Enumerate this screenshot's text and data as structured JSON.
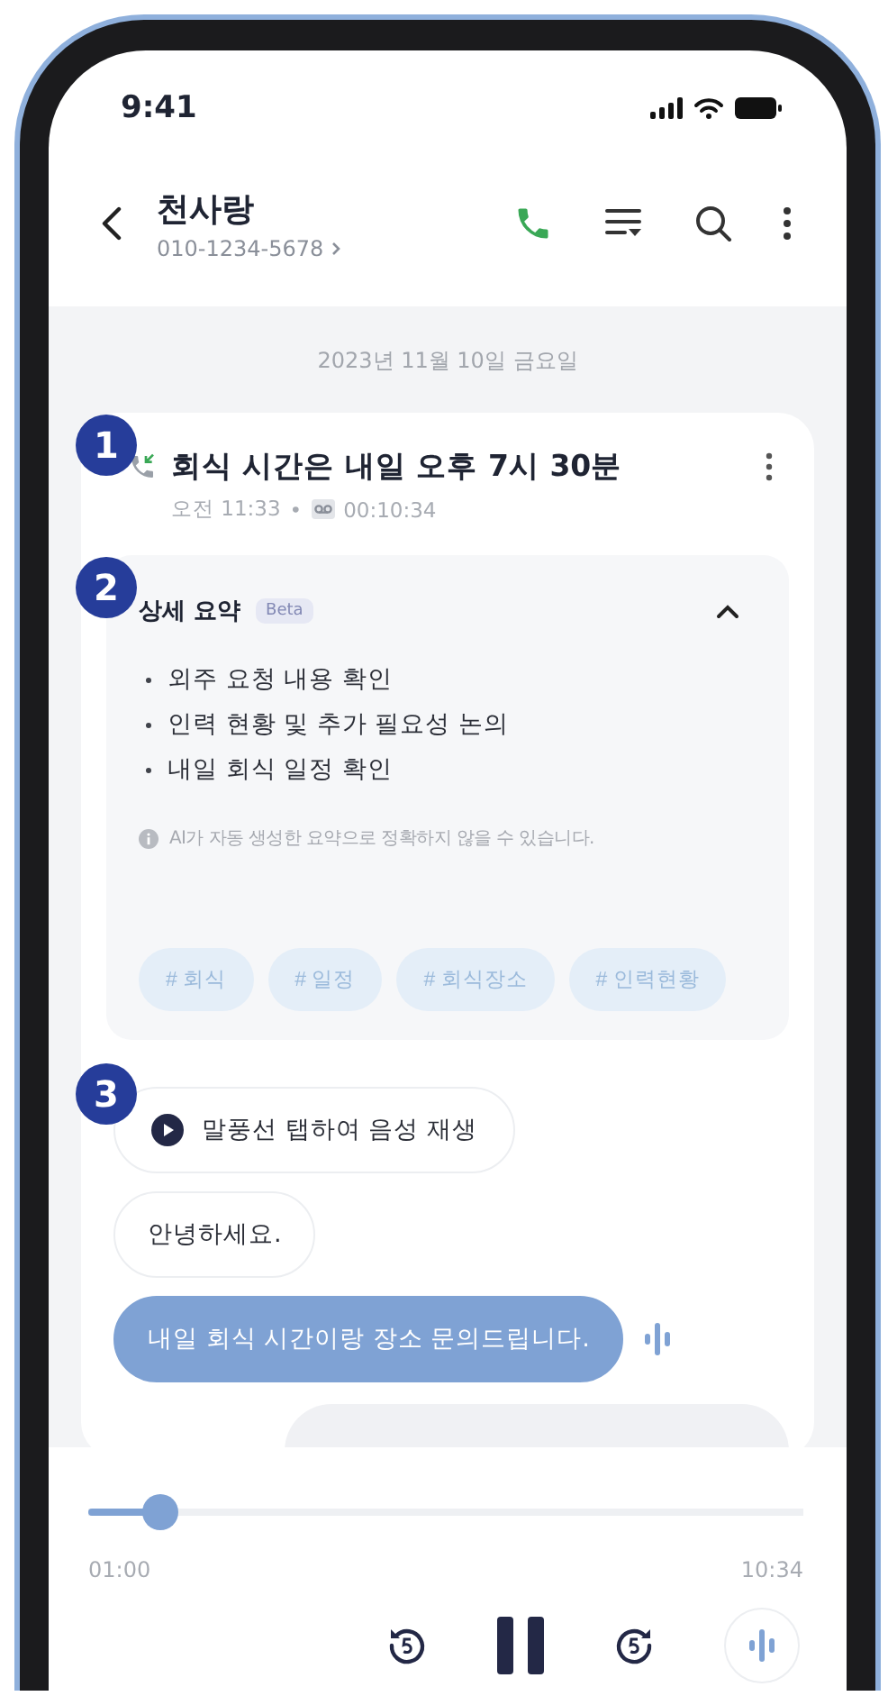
{
  "status_bar": {
    "time": "9:41"
  },
  "header": {
    "contact_name": "천사랑",
    "phone_number": "010-1234-5678"
  },
  "date_divider": "2023년 11월 10일 금요일",
  "call_card": {
    "title": "회식 시간은 내일 오후 7시 30분",
    "time": "오전 11:33",
    "separator": "•",
    "duration": "00:10:34"
  },
  "summary": {
    "title": "상세 요약",
    "badge": "Beta",
    "expanded": true,
    "points": [
      "외주 요청 내용 확인",
      "인력 현황 및 추가 필요성 논의",
      "내일 회식 일정 확인"
    ],
    "notice": "AI가 자동 생성한 요약으로 정확하지 않을 수 있습니다.",
    "tags": [
      "# 회식",
      "# 일정",
      "# 회식장소",
      "# 인력현황"
    ]
  },
  "messages": [
    {
      "kind": "hint",
      "text": "말풍선 탭하여 음성 재생"
    },
    {
      "kind": "bubble",
      "text": "안녕하세요.",
      "selected": false
    },
    {
      "kind": "bubble",
      "text": "내일 회식 시간이랑 장소 문의드립니다.",
      "selected": true
    }
  ],
  "player": {
    "level": 0.1,
    "elapsed": "01:00",
    "total": "10:34",
    "playing": true
  },
  "markers": [
    "1",
    "2",
    "3"
  ]
}
